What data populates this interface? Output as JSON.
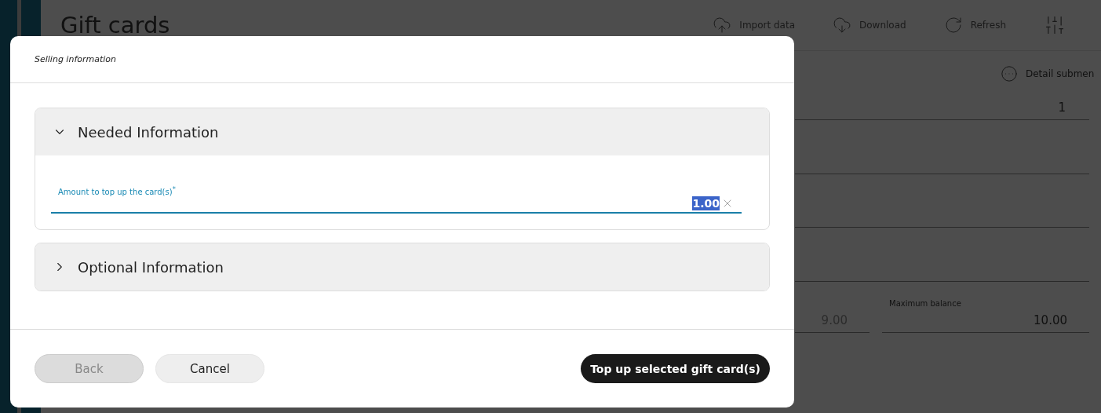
{
  "page": {
    "title": "Gift cards",
    "toolbar": [
      {
        "kind": "upload",
        "label": "Import data"
      },
      {
        "kind": "download",
        "label": "Download"
      },
      {
        "kind": "refresh",
        "label": "Refresh"
      },
      {
        "kind": "settings"
      }
    ],
    "detail_submenu": "Detail submen",
    "quantity_value": "1",
    "balance_fields": [
      {
        "value": "9.00"
      },
      {
        "label": "Maximum balance",
        "value": "10.00"
      }
    ]
  },
  "dialog": {
    "title": "Selling information",
    "sections": [
      {
        "title": "Needed Information",
        "expanded": true,
        "fields": [
          {
            "label": "Amount to top up the card(s)",
            "required_mark": "*",
            "value": "1.00",
            "selected": true
          }
        ]
      },
      {
        "title": "Optional Information",
        "expanded": false
      }
    ],
    "buttons": [
      {
        "label": "Back",
        "kind": "secondary",
        "disabled": true
      },
      {
        "label": "Cancel",
        "kind": "secondary",
        "disabled": false
      },
      {
        "label": "Top up selected gift card(s)",
        "kind": "primary",
        "disabled": false
      }
    ]
  }
}
